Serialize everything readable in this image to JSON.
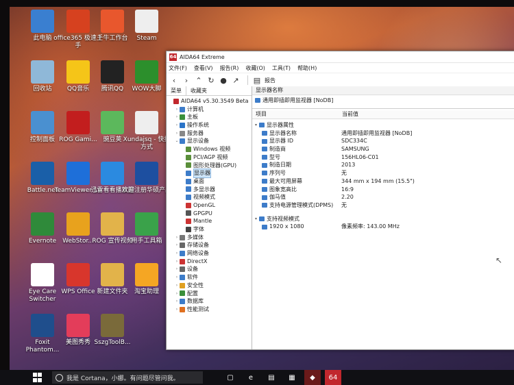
{
  "desktop_icons": [
    {
      "label": "此电脑",
      "icon": "computer-icon",
      "color": "#3a7fd0"
    },
    {
      "label": "office365 极速上手",
      "icon": "office-icon",
      "color": "#d6411f"
    },
    {
      "label": "千牛工作台",
      "icon": "qianniu-icon",
      "color": "#e8572d"
    },
    {
      "label": "Steam",
      "icon": "file-icon",
      "color": "#eeeeee"
    },
    {
      "label": "回收站",
      "icon": "recycle-bin-icon",
      "color": "#8fb8d8"
    },
    {
      "label": "QQ音乐",
      "icon": "qq-music-icon",
      "color": "#f5c518"
    },
    {
      "label": "腾讯QQ",
      "icon": "qq-penguin-icon",
      "color": "#222222"
    },
    {
      "label": "WOW大脚",
      "icon": "wow-paw-icon",
      "color": "#2c8f2c"
    },
    {
      "label": "控制面板",
      "icon": "control-panel-icon",
      "color": "#4a90d0"
    },
    {
      "label": "ROG Gami...",
      "icon": "rog-icon",
      "color": "#c21e1e"
    },
    {
      "label": "豌豆荚",
      "icon": "wandoujia-icon",
      "color": "#5cb85c"
    },
    {
      "label": "Xundajsq - 快捷方式",
      "icon": "file-icon",
      "color": "#eeeeee"
    },
    {
      "label": "Battle.net",
      "icon": "battlenet-icon",
      "color": "#1a5fa8"
    },
    {
      "label": "TeamViewer 10",
      "icon": "teamviewer-icon",
      "color": "#1e6fd9"
    },
    {
      "label": "迅雷看看播放器",
      "icon": "xunlei-icon",
      "color": "#2b8ae0"
    },
    {
      "label": "欢迎注册华硕产品",
      "icon": "asus-icon",
      "color": "#1d4fa0"
    },
    {
      "label": "Evernote",
      "icon": "evernote-icon",
      "color": "#2f8a3a"
    },
    {
      "label": "WebStor...",
      "icon": "webstorage-icon",
      "color": "#e8a21d"
    },
    {
      "label": "ROG 宣传视频",
      "icon": "folder-icon",
      "color": "#e2b34a"
    },
    {
      "label": "用手工具箱",
      "icon": "toolbox-icon",
      "color": "#3aa24a"
    },
    {
      "label": "Eye Care Switcher",
      "icon": "eye-care-icon",
      "color": "#ffffff"
    },
    {
      "label": "WPS Office",
      "icon": "wps-icon",
      "color": "#d8362c"
    },
    {
      "label": "新建文件夹",
      "icon": "folder-icon",
      "color": "#e2b34a"
    },
    {
      "label": "淘宝助理",
      "icon": "taobao-icon",
      "color": "#f5a623"
    },
    {
      "label": "Foxit Phantom...",
      "icon": "foxit-icon",
      "color": "#1f4e8c"
    },
    {
      "label": "美图秀秀",
      "icon": "meitu-icon",
      "color": "#e33d5a"
    },
    {
      "label": "SszgToolB...",
      "icon": "sszg-tool-icon",
      "color": "#7a6a3a"
    }
  ],
  "window": {
    "title": "AIDA64 Extreme",
    "app_badge": "64",
    "menu": [
      "文件(F)",
      "查看(V)",
      "报告(R)",
      "收藏(O)",
      "工具(T)",
      "帮助(H)"
    ],
    "toolbar_report": "报告",
    "left_tabs": [
      "菜单",
      "收藏夹"
    ],
    "tree": [
      {
        "label": "AIDA64 v5.30.3549 Beta",
        "level": 0,
        "arrow": "",
        "color": "#c1272d"
      },
      {
        "label": "计算机",
        "level": 1,
        "arrow": "›",
        "color": "#3d7cc9"
      },
      {
        "label": "主板",
        "level": 1,
        "arrow": "›",
        "color": "#3a8f3a"
      },
      {
        "label": "操作系统",
        "level": 1,
        "arrow": "›",
        "color": "#2b74c8"
      },
      {
        "label": "服务器",
        "level": 1,
        "arrow": "›",
        "color": "#888888"
      },
      {
        "label": "显示设备",
        "level": 1,
        "arrow": "⌄",
        "color": "#3d7cc9"
      },
      {
        "label": "Windows 视频",
        "level": 2,
        "arrow": "",
        "color": "#5a8f3a"
      },
      {
        "label": "PCI/AGP 视频",
        "level": 2,
        "arrow": "",
        "color": "#5a8f3a"
      },
      {
        "label": "图形处理器(GPU)",
        "level": 2,
        "arrow": "",
        "color": "#5a8f3a"
      },
      {
        "label": "显示器",
        "level": 2,
        "arrow": "",
        "color": "#3d7cc9",
        "selected": true
      },
      {
        "label": "桌面",
        "level": 2,
        "arrow": "",
        "color": "#3d7cc9"
      },
      {
        "label": "多显示器",
        "level": 2,
        "arrow": "",
        "color": "#3d7cc9"
      },
      {
        "label": "视频模式",
        "level": 2,
        "arrow": "",
        "color": "#3d7cc9"
      },
      {
        "label": "OpenGL",
        "level": 2,
        "arrow": "",
        "color": "#c33"
      },
      {
        "label": "GPGPU",
        "level": 2,
        "arrow": "",
        "color": "#555"
      },
      {
        "label": "Mantle",
        "level": 2,
        "arrow": "",
        "color": "#c33"
      },
      {
        "label": "字体",
        "level": 2,
        "arrow": "",
        "color": "#444"
      },
      {
        "label": "多媒体",
        "level": 1,
        "arrow": "›",
        "color": "#777"
      },
      {
        "label": "存储设备",
        "level": 1,
        "arrow": "›",
        "color": "#666"
      },
      {
        "label": "网络设备",
        "level": 1,
        "arrow": "›",
        "color": "#3d7cc9"
      },
      {
        "label": "DirectX",
        "level": 1,
        "arrow": "›",
        "color": "#c33"
      },
      {
        "label": "设备",
        "level": 1,
        "arrow": "›",
        "color": "#666"
      },
      {
        "label": "软件",
        "level": 1,
        "arrow": "›",
        "color": "#3d7cc9"
      },
      {
        "label": "安全性",
        "level": 1,
        "arrow": "›",
        "color": "#e0a020"
      },
      {
        "label": "配置",
        "level": 1,
        "arrow": "›",
        "color": "#3a8f3a"
      },
      {
        "label": "数据库",
        "level": 1,
        "arrow": "›",
        "color": "#3d7cc9"
      },
      {
        "label": "性能测试",
        "level": 1,
        "arrow": "›",
        "color": "#e07020"
      }
    ],
    "monitor_header": "显示器名称",
    "monitor_name": "通用即插即用监视器 [NoDB]",
    "columns": {
      "item": "项目",
      "value": "当前值"
    },
    "section_props": "显示器属性",
    "props": [
      {
        "field": "显示器名称",
        "value": "通用即插即用监视器 [NoDB]"
      },
      {
        "field": "显示器 ID",
        "value": "SDC334C"
      },
      {
        "field": "制造商",
        "value": "SAMSUNG"
      },
      {
        "field": "型号",
        "value": "156HL06-C01"
      },
      {
        "field": "制造日期",
        "value": "2013"
      },
      {
        "field": "序列号",
        "value": "无"
      },
      {
        "field": "最大可用屏幕",
        "value": "344 mm x 194 mm (15.5\")"
      },
      {
        "field": "图象宽高比",
        "value": "16:9"
      },
      {
        "field": "伽马值",
        "value": "2.20"
      },
      {
        "field": "支持电源管理模式(DPMS)",
        "value": "无"
      }
    ],
    "section_modes": "支持视频模式",
    "modes": [
      {
        "field": "1920 x 1080",
        "value": "像素频率: 143.00 MHz"
      }
    ]
  },
  "taskbar": {
    "search_text": "我是 Cortana，小娜。有问题尽管问我。",
    "app_badge": "64",
    "icons": [
      "task-view-icon",
      "edge-icon",
      "file-explorer-icon",
      "store-icon",
      "rog-app-icon",
      "aida64-icon"
    ]
  }
}
